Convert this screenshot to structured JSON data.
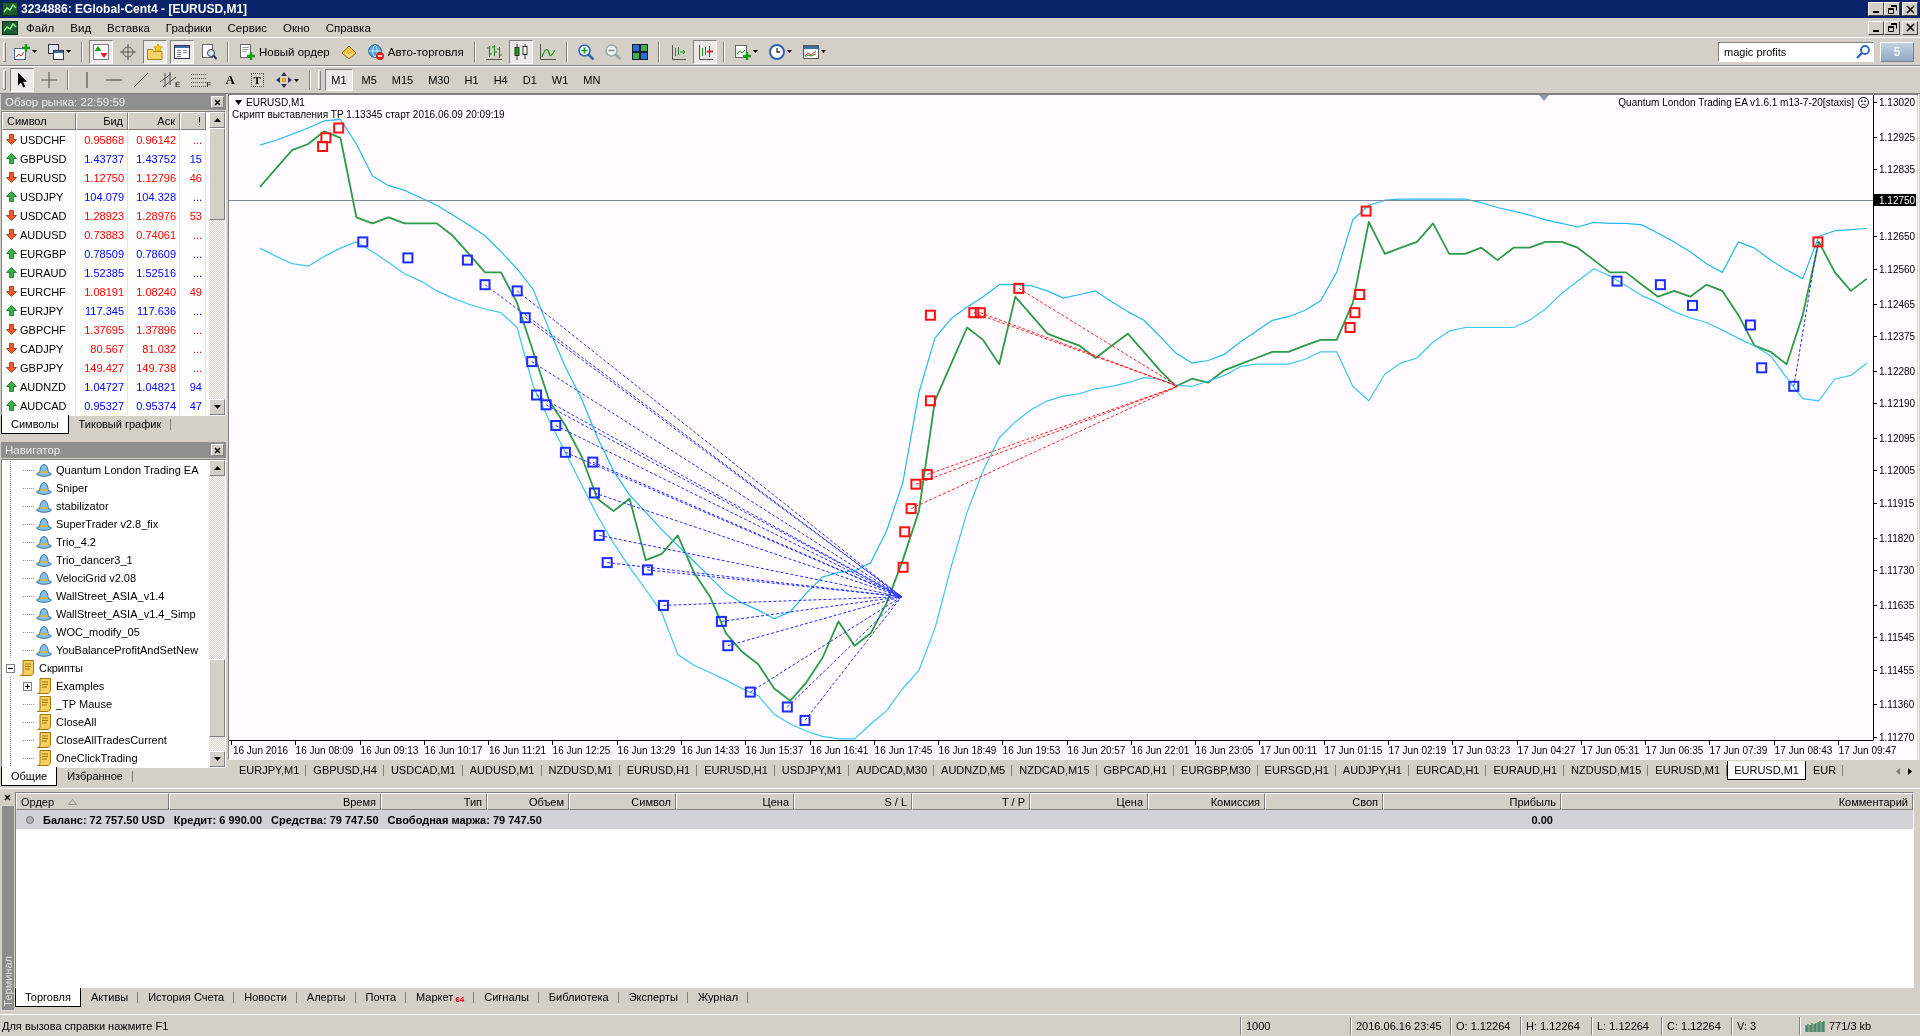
{
  "window": {
    "title": "3234886: EGlobal-Cent4 - [EURUSD,M1]"
  },
  "menu": [
    "Файл",
    "Вид",
    "Вставка",
    "Графики",
    "Сервис",
    "Окно",
    "Справка"
  ],
  "toolbar": {
    "groups": [
      [
        {
          "kind": "new_chart",
          "pressed": false
        },
        {
          "kind": "profiles",
          "pressed": false
        }
      ],
      [
        {
          "kind": "market_watch",
          "pressed": true
        },
        {
          "kind": "data_window",
          "pressed": false
        },
        {
          "kind": "navigator",
          "pressed": true
        },
        {
          "kind": "terminal",
          "pressed": true
        },
        {
          "kind": "tester",
          "pressed": false
        }
      ],
      [
        {
          "kind": "new_order",
          "label": "Новый ордер",
          "pressed": false
        },
        {
          "kind": "metaeditor",
          "pressed": false
        },
        {
          "kind": "autotrading",
          "label": "Авто-торговля",
          "pressed": false
        }
      ],
      [
        {
          "kind": "bar_chart",
          "pressed": false
        },
        {
          "kind": "candles",
          "pressed": true
        },
        {
          "kind": "line_chart",
          "pressed": false
        }
      ],
      [
        {
          "kind": "zoom_in",
          "pressed": false
        },
        {
          "kind": "zoom_out",
          "pressed": false
        },
        {
          "kind": "tile",
          "pressed": false
        }
      ],
      [
        {
          "kind": "chart_shift",
          "pressed": false
        },
        {
          "kind": "autoscroll",
          "pressed": true
        }
      ],
      [
        {
          "kind": "indicators",
          "pressed": false
        },
        {
          "kind": "periods",
          "pressed": false
        },
        {
          "kind": "templates",
          "pressed": false
        }
      ]
    ],
    "search": {
      "value": "magic profits"
    },
    "messages": "5"
  },
  "drawing_tools": {
    "groups": [
      [
        {
          "kind": "cursor",
          "pressed": true
        },
        {
          "kind": "crosshair",
          "pressed": false
        }
      ],
      [
        {
          "kind": "vline",
          "pressed": false
        },
        {
          "kind": "hline",
          "pressed": false
        },
        {
          "kind": "trendline",
          "pressed": false
        },
        {
          "kind": "channel",
          "glyph": "E",
          "pressed": false
        },
        {
          "kind": "fibo",
          "glyph": "F",
          "pressed": false
        },
        {
          "kind": "text",
          "glyph": "A",
          "pressed": false
        },
        {
          "kind": "label",
          "glyph": "T",
          "pressed": false
        },
        {
          "kind": "arrows",
          "pressed": false
        }
      ]
    ]
  },
  "timeframes": [
    {
      "label": "M1",
      "selected": true
    },
    {
      "label": "M5",
      "selected": false
    },
    {
      "label": "M15",
      "selected": false
    },
    {
      "label": "M30",
      "selected": false
    },
    {
      "label": "H1",
      "selected": false
    },
    {
      "label": "H4",
      "selected": false
    },
    {
      "label": "D1",
      "selected": false
    },
    {
      "label": "W1",
      "selected": false
    },
    {
      "label": "MN",
      "selected": false
    }
  ],
  "market_watch": {
    "title": "Обзор рынка: 22:59:59",
    "columns": [
      "Символ",
      "Бид",
      "Аск",
      "!"
    ],
    "rows": [
      {
        "symbol": "USDCHF",
        "kind": "down",
        "bid": "0.95868",
        "ask": "0.96142",
        "spread": "..."
      },
      {
        "symbol": "GBPUSD",
        "kind": "up",
        "bid": "1.43737",
        "ask": "1.43752",
        "spread": "15"
      },
      {
        "symbol": "EURUSD",
        "kind": "down",
        "bid": "1.12750",
        "ask": "1.12796",
        "spread": "46"
      },
      {
        "symbol": "USDJPY",
        "kind": "up",
        "bid": "104.079",
        "ask": "104.328",
        "spread": "..."
      },
      {
        "symbol": "USDCAD",
        "kind": "down",
        "bid": "1.28923",
        "ask": "1.28976",
        "spread": "53"
      },
      {
        "symbol": "AUDUSD",
        "kind": "down",
        "bid": "0.73883",
        "ask": "0.74061",
        "spread": "..."
      },
      {
        "symbol": "EURGBP",
        "kind": "up",
        "bid": "0.78509",
        "ask": "0.78609",
        "spread": "..."
      },
      {
        "symbol": "EURAUD",
        "kind": "up",
        "bid": "1.52385",
        "ask": "1.52516",
        "spread": "..."
      },
      {
        "symbol": "EURCHF",
        "kind": "down",
        "bid": "1.08191",
        "ask": "1.08240",
        "spread": "49"
      },
      {
        "symbol": "EURJPY",
        "kind": "up",
        "bid": "117.345",
        "ask": "117.636",
        "spread": "..."
      },
      {
        "symbol": "GBPCHF",
        "kind": "down",
        "bid": "1.37695",
        "ask": "1.37896",
        "spread": "..."
      },
      {
        "symbol": "CADJPY",
        "kind": "down",
        "bid": "80.567",
        "ask": "81.032",
        "spread": "..."
      },
      {
        "symbol": "GBPJPY",
        "kind": "down",
        "bid": "149.427",
        "ask": "149.738",
        "spread": "..."
      },
      {
        "symbol": "AUDNZD",
        "kind": "up",
        "bid": "1.04727",
        "ask": "1.04821",
        "spread": "94"
      },
      {
        "symbol": "AUDCAD",
        "kind": "up",
        "bid": "0.95327",
        "ask": "0.95374",
        "spread": "47"
      }
    ],
    "tabs": [
      {
        "label": "Символы",
        "selected": true
      },
      {
        "label": "Тиковый график",
        "selected": false
      }
    ]
  },
  "navigator": {
    "title": "Навигатор",
    "tree": [
      {
        "children": [
          {
            "label": "Quantum London Trading EA",
            "kind": "expert"
          },
          {
            "label": "Sniper",
            "kind": "expert"
          },
          {
            "label": "stabilizator",
            "kind": "expert"
          },
          {
            "label": "SuperTrader v2.8_fix",
            "kind": "expert"
          },
          {
            "label": "Trio_4.2",
            "kind": "expert"
          },
          {
            "label": "Trio_dancer3_1",
            "kind": "expert"
          },
          {
            "label": "VelociGrid v2.08",
            "kind": "expert"
          },
          {
            "label": "WallStreet_ASIA_v1.4",
            "kind": "expert"
          },
          {
            "label": "WallStreet_ASIA_v1.4_Simp",
            "kind": "expert"
          },
          {
            "label": "WOC_modify_05",
            "kind": "expert"
          },
          {
            "label": "YouBalanceProfitAndSetNew",
            "kind": "expert"
          }
        ]
      },
      {
        "label": "Скрипты",
        "kind": "folder",
        "expanded": true,
        "children": [
          {
            "label": "Examples",
            "kind": "folder",
            "expanded": false
          },
          {
            "label": "_TP Mause",
            "kind": "script"
          },
          {
            "label": "CloseAll",
            "kind": "script"
          },
          {
            "label": "CloseAllTradesCurrent",
            "kind": "script"
          },
          {
            "label": "OneClickTrading",
            "kind": "script"
          }
        ]
      }
    ],
    "tabs": [
      {
        "label": "Общие",
        "selected": true
      },
      {
        "label": "Избранное",
        "selected": false
      }
    ]
  },
  "chart": {
    "symbol": "EURUSD,M1",
    "comment": "Скрипт выставления TP 1.13345 старт 2016.06.09 20:09:19",
    "expert": "Quantum London Trading EA v1.6.1 m13-7-20[staxis]",
    "chart_data": {
      "type": "line",
      "categories": [
        "16 Jun 2016",
        null,
        null,
        null,
        "16 Jun 08:09",
        null,
        null,
        null,
        "16 Jun 09:13",
        null,
        null,
        null,
        "16 Jun 10:17",
        null,
        null,
        null,
        "16 Jun 11:21",
        null,
        null,
        null,
        "16 Jun 12:25",
        null,
        null,
        null,
        "16 Jun 13:29",
        null,
        null,
        null,
        "16 Jun 14:33",
        null,
        null,
        null,
        "16 Jun 15:37",
        null,
        null,
        null,
        "16 Jun 16:41",
        null,
        null,
        null,
        "16 Jun 17:45",
        null,
        null,
        null,
        "16 Jun 18:49",
        null,
        null,
        null,
        "16 Jun 19:53",
        null,
        null,
        null,
        "16 Jun 20:57",
        null,
        null,
        null,
        "16 Jun 22:01",
        null,
        null,
        null,
        "16 Jun 23:05",
        null,
        null,
        null,
        "17 Jun 00:11",
        null,
        null,
        null,
        "17 Jun 01:15",
        null,
        null,
        null,
        "17 Jun 02:19",
        null,
        null,
        null,
        "17 Jun 03:23",
        null,
        null,
        null,
        "17 Jun 04:27",
        null,
        null,
        null,
        "17 Jun 05:31",
        null,
        null,
        null,
        "17 Jun 06:35",
        null,
        null,
        null,
        "17 Jun 07:39",
        null,
        null,
        null,
        "17 Jun 08:43",
        null,
        null,
        null,
        "17 Jun 09:47"
      ],
      "ylim": [
        1.11262,
        1.1304
      ],
      "yticks": [
        {
          "value": 1.1302,
          "label": "1.13020"
        },
        {
          "value": 1.12925,
          "label": "1.12925"
        },
        {
          "value": 1.12835,
          "label": "1.12835"
        },
        {
          "value": 1.1265,
          "label": "1.12650"
        },
        {
          "value": 1.1256,
          "label": "1.12560"
        },
        {
          "value": 1.12465,
          "label": "1.12465"
        },
        {
          "value": 1.12375,
          "label": "1.12375"
        },
        {
          "value": 1.1228,
          "label": "1.12280"
        },
        {
          "value": 1.1219,
          "label": "1.12190"
        },
        {
          "value": 1.12095,
          "label": "1.12095"
        },
        {
          "value": 1.12005,
          "label": "1.12005"
        },
        {
          "value": 1.11915,
          "label": "1.11915"
        },
        {
          "value": 1.1182,
          "label": "1.11820"
        },
        {
          "value": 1.1173,
          "label": "1.11730"
        },
        {
          "value": 1.11635,
          "label": "1.11635"
        },
        {
          "value": 1.11545,
          "label": "1.11545"
        },
        {
          "value": 1.11455,
          "label": "1.11455"
        },
        {
          "value": 1.1136,
          "label": "1.11360"
        },
        {
          "value": 1.1127,
          "label": "1.11270"
        }
      ],
      "series": [
        {
          "color": "#2e9b48",
          "values": [
            1.12787,
            1.12838,
            1.12888,
            1.12905,
            1.1294,
            1.12922,
            1.12703,
            1.12686,
            1.12703,
            1.12686,
            1.12686,
            1.12686,
            1.12652,
            1.12602,
            1.12551,
            1.12551,
            1.12467,
            1.12332,
            1.12197,
            1.12129,
            1.12045,
            1.11927,
            1.11893,
            1.11927,
            1.11758,
            1.11775,
            1.11826,
            1.11724,
            1.11657,
            1.11556,
            1.11505,
            1.11471,
            1.11404,
            1.1137,
            1.11421,
            1.11488,
            1.11589,
            1.11522,
            1.11556,
            1.1164,
            1.11758,
            1.11893,
            1.12197,
            1.12298,
            1.12399,
            1.12365,
            1.12298,
            1.12484,
            1.12433,
            1.12382,
            1.12365,
            1.12349,
            1.12315,
            1.12349,
            1.12382,
            1.12332,
            1.12281,
            1.12237,
            1.12258,
            1.12247,
            1.12281,
            1.12298,
            1.12315,
            1.12332,
            1.12332,
            1.12349,
            1.12365,
            1.12365,
            1.12467,
            1.1269,
            1.12602,
            1.12619,
            1.12635,
            1.12686,
            1.12602,
            1.12602,
            1.12619,
            1.12585,
            1.12619,
            1.12619,
            1.12635,
            1.12635,
            1.12619,
            1.12585,
            1.12551,
            1.12551,
            1.12517,
            1.12484,
            1.125,
            1.12484,
            1.12517,
            1.125,
            1.12433,
            1.12349,
            1.12332,
            1.12298,
            1.12433,
            1.12635,
            1.12551,
            1.125,
            1.12534
          ]
        },
        {
          "color": "#22bbee",
          "values": [
            1.12902,
            1.12915,
            1.12932,
            1.12949,
            1.12969,
            1.12973,
            1.12905,
            1.12817,
            1.1279,
            1.12777,
            1.12757,
            1.12736,
            1.12709,
            1.12682,
            1.12652,
            1.12608,
            1.12561,
            1.12504,
            1.12392,
            1.12291,
            1.12203,
            1.12095,
            1.12004,
            1.11937,
            1.1189,
            1.11842,
            1.11798,
            1.11755,
            1.11711,
            1.11667,
            1.1164,
            1.1162,
            1.11596,
            1.11616,
            1.11667,
            1.11711,
            1.11724,
            1.11728,
            1.11751,
            1.11839,
            1.11971,
            1.1222,
            1.12369,
            1.12423,
            1.12456,
            1.12484,
            1.12517,
            1.12517,
            1.12514,
            1.125,
            1.1248,
            1.1249,
            1.125,
            1.1247,
            1.12443,
            1.12419,
            1.12375,
            1.12328,
            1.12301,
            1.12308,
            1.12325,
            1.12359,
            1.12389,
            1.12419,
            1.12429,
            1.12446,
            1.12473,
            1.12551,
            1.12696,
            1.12736,
            1.1275,
            1.12753,
            1.12753,
            1.12753,
            1.12753,
            1.12753,
            1.12743,
            1.1273,
            1.1272,
            1.12709,
            1.12696,
            1.12686,
            1.12676,
            1.12689,
            1.12686,
            1.12686,
            1.12682,
            1.12659,
            1.12635,
            1.12608,
            1.12575,
            1.12551,
            1.12635,
            1.12618,
            1.12585,
            1.12558,
            1.12534,
            1.1265,
            1.12666,
            1.12669,
            1.12672
          ]
        },
        {
          "color": "#3cc6f2",
          "values": [
            1.12618,
            1.12595,
            1.12575,
            1.12568,
            1.12595,
            1.12618,
            1.12635,
            1.12608,
            1.12578,
            1.12547,
            1.12527,
            1.125,
            1.1248,
            1.12463,
            1.1245,
            1.1244,
            1.12399,
            1.12237,
            1.12143,
            1.12055,
            1.11967,
            1.1188,
            1.11805,
            1.11738,
            1.11677,
            1.11613,
            1.11498,
            1.11468,
            1.11448,
            1.11427,
            1.11404,
            1.11384,
            1.11333,
            1.11306,
            1.11286,
            1.11272,
            1.11265,
            1.11265,
            1.11306,
            1.11343,
            1.11404,
            1.11454,
            1.11569,
            1.11738,
            1.1189,
            1.12004,
            1.12095,
            1.12139,
            1.12173,
            1.12197,
            1.1221,
            1.12217,
            1.1223,
            1.12237,
            1.12247,
            1.12261,
            1.12257,
            1.1224,
            1.12237,
            1.12251,
            1.12267,
            1.12291,
            1.12298,
            1.12298,
            1.12298,
            1.12311,
            1.12332,
            1.12332,
            1.12237,
            1.12197,
            1.12271,
            1.12301,
            1.12315,
            1.12359,
            1.12389,
            1.12399,
            1.12399,
            1.12399,
            1.12399,
            1.12419,
            1.1245,
            1.12493,
            1.12527,
            1.12561,
            1.12541,
            1.12514,
            1.12487,
            1.12467,
            1.12443,
            1.12426,
            1.12413,
            1.12392,
            1.12369,
            1.12348,
            1.12321,
            1.12261,
            1.12203,
            1.12197,
            1.12257,
            1.12267,
            1.12301
          ]
        }
      ],
      "ref_lines": [
        {
          "axis": "y",
          "value": 1.1275,
          "label": "1.12750"
        }
      ]
    },
    "tabs": [
      {
        "label": "EURJPY,M1",
        "selected": false
      },
      {
        "label": "GBPUSD,H4",
        "selected": false
      },
      {
        "label": "USDCAD,M1",
        "selected": false
      },
      {
        "label": "AUDUSD,M1",
        "selected": false
      },
      {
        "label": "NZDUSD,M1",
        "selected": false
      },
      {
        "label": "EURUSD,H1",
        "selected": false
      },
      {
        "label": "EURUSD,H1",
        "selected": false
      },
      {
        "label": "USDJPY,M1",
        "selected": false
      },
      {
        "label": "AUDCAD,M30",
        "selected": false
      },
      {
        "label": "AUDNZD,M5",
        "selected": false
      },
      {
        "label": "NZDCAD,M15",
        "selected": false
      },
      {
        "label": "GBPCAD,H1",
        "selected": false
      },
      {
        "label": "EURGBP,M30",
        "selected": false
      },
      {
        "label": "EURSGD,H1",
        "selected": false
      },
      {
        "label": "AUDJPY,H1",
        "selected": false
      },
      {
        "label": "EURCAD,H1",
        "selected": false
      },
      {
        "label": "EURAUD,H1",
        "selected": false
      },
      {
        "label": "NZDUSD,M15",
        "selected": false
      },
      {
        "label": "EURUSD,M1",
        "selected": false
      },
      {
        "label": "EURUSD,M1",
        "selected": true
      },
      {
        "label": "EUR",
        "selected": false
      }
    ]
  },
  "terminal": {
    "title": "Терминал",
    "columns": [
      {
        "label": "Ордер",
        "sorted": true
      },
      {
        "label": "Время",
        "sorted": false
      },
      {
        "label": "Тип",
        "sorted": false
      },
      {
        "label": "Объем",
        "sorted": false
      },
      {
        "label": "Символ",
        "sorted": false
      },
      {
        "label": "Цена",
        "sorted": false
      },
      {
        "label": "S / L",
        "sorted": false
      },
      {
        "label": "T / P",
        "sorted": false
      },
      {
        "label": "Цена",
        "sorted": false
      },
      {
        "label": "Комиссия",
        "sorted": false
      },
      {
        "label": "Своп",
        "sorted": false
      },
      {
        "label": "Прибыль",
        "sorted": false
      },
      {
        "label": "Комментарий",
        "sorted": false
      }
    ],
    "summary": [
      "Баланс: 72 757.50 USD",
      "Кредит: 6 990.00",
      "Средства: 79 747.50",
      "Свободная маржа: 79 747.50"
    ],
    "profit": "0.00",
    "tabs": [
      {
        "label": "Торговля",
        "selected": true
      },
      {
        "label": "Активы",
        "selected": false
      },
      {
        "label": "История Счета",
        "selected": false
      },
      {
        "label": "Новости",
        "selected": false
      },
      {
        "label": "Алерты",
        "selected": false
      },
      {
        "label": "Почта",
        "selected": false
      },
      {
        "label": "Маркет",
        "badge": "64",
        "selected": false
      },
      {
        "label": "Сигналы",
        "selected": false
      },
      {
        "label": "Библиотека",
        "selected": false
      },
      {
        "label": "Эксперты",
        "selected": false
      },
      {
        "label": "Журнал",
        "selected": false
      }
    ]
  },
  "status_bar": {
    "help": "Для вызова справки нажмите F1",
    "bars": "1000",
    "datetime": "2016.06.16 23:45",
    "open": "O: 1.12264",
    "high": "H: 1.12264",
    "low": "L: 1.12264",
    "close": "C: 1.12264",
    "volume": "V: 3",
    "traffic": "771/3 kb"
  }
}
